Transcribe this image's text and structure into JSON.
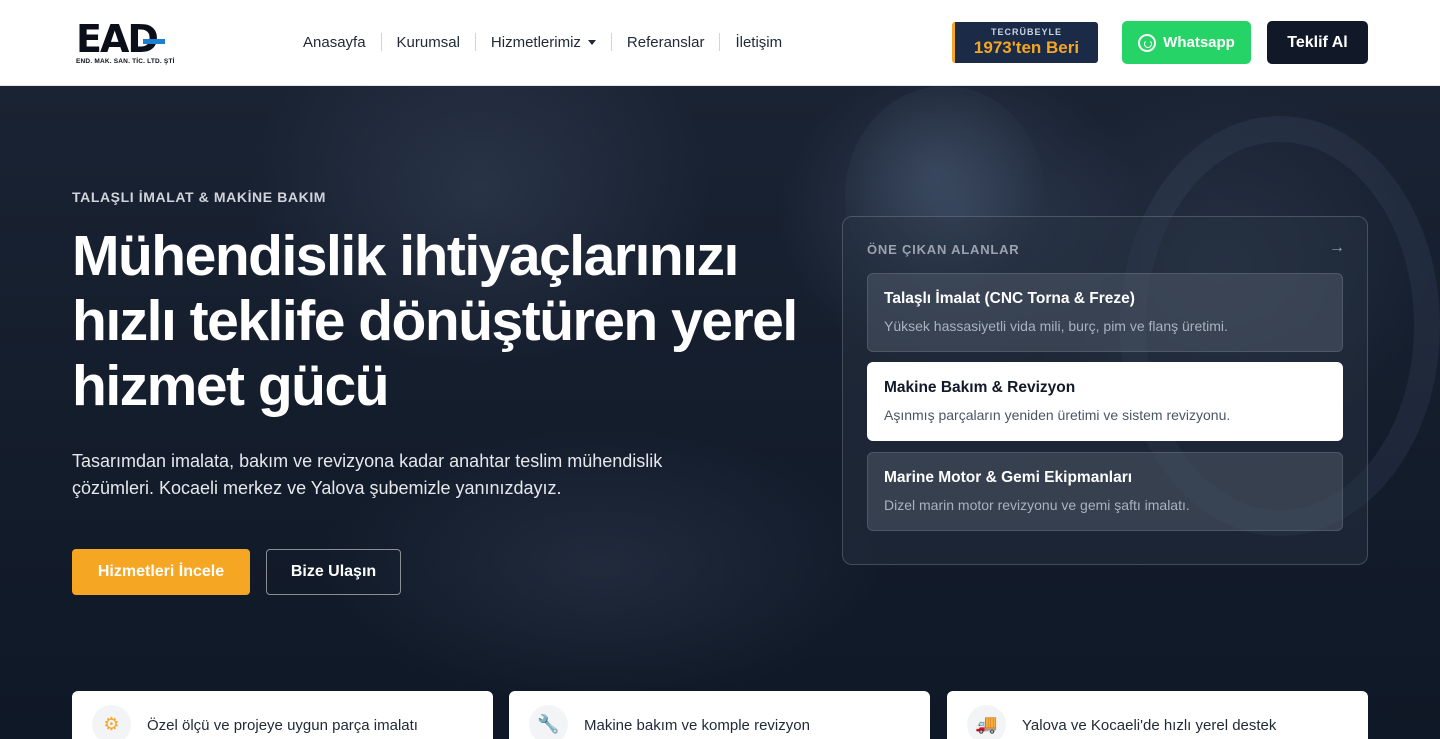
{
  "brand": {
    "logo_text": "EAD",
    "logo_subtext": "END. MAK. SAN. TİC. LTD. ŞTİ"
  },
  "nav": {
    "items": [
      {
        "label": "Anasayfa"
      },
      {
        "label": "Kurumsal"
      },
      {
        "label": "Hizmetlerimiz"
      },
      {
        "label": "Referanslar"
      },
      {
        "label": "İletişim"
      }
    ]
  },
  "header_actions": {
    "experience_top": "TECRÜBEYLE",
    "experience_bottom": "1973'ten Beri",
    "whatsapp_label": "Whatsapp",
    "quote_label": "Teklif Al"
  },
  "hero": {
    "eyebrow": "TALAŞLI İMALAT & MAKİNE BAKIM",
    "headline": "Mühendislik ihtiyaçlarınızı hızlı teklife dönüştüren yerel hizmet gücü",
    "lead": "Tasarımdan imalata, bakım ve revizyona kadar anahtar teslim mühendislik çözümleri. Kocaeli merkez ve Yalova şubemizle yanınızdayız.",
    "primary_button": "Hizmetleri İncele",
    "secondary_button": "Bize Ulaşın"
  },
  "featured": {
    "title": "ÖNE ÇIKAN ALANLAR",
    "arrow": "→",
    "items": [
      {
        "title": "Talaşlı İmalat (CNC Torna & Freze)",
        "desc": "Yüksek hassasiyetli vida mili, burç, pim ve flanş üretimi."
      },
      {
        "title": "Makine Bakım & Revizyon",
        "desc": "Aşınmış parçaların yeniden üretimi ve sistem revizyonu."
      },
      {
        "title": "Marine Motor & Gemi Ekipmanları",
        "desc": "Dizel marin motor revizyonu ve gemi şaftı imalatı."
      }
    ]
  },
  "features": [
    {
      "icon": "gear-icon",
      "label": "Özel ölçü ve projeye uygun parça imalatı"
    },
    {
      "icon": "wrench-icon",
      "label": "Makine bakım ve komple revizyon"
    },
    {
      "icon": "truck-icon",
      "label": "Yalova ve Kocaeli'de hızlı yerel destek"
    }
  ],
  "colors": {
    "accent": "#f5a623",
    "whatsapp": "#25d366",
    "dark": "#111827"
  }
}
